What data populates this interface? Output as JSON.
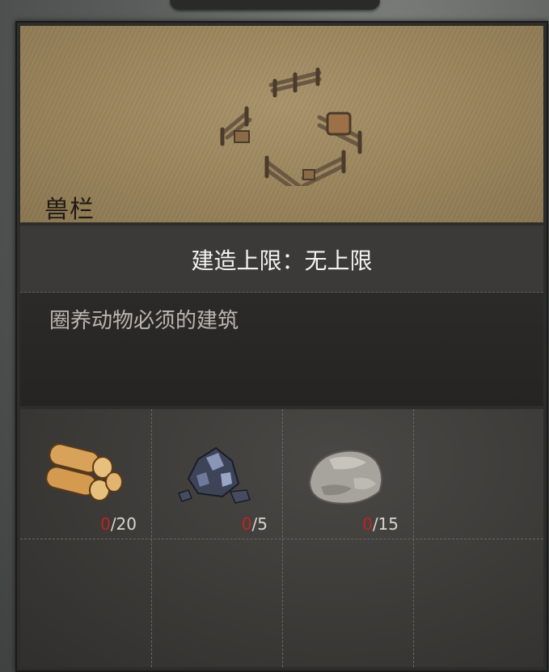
{
  "building": {
    "name": "兽栏",
    "limit_text": "建造上限：无上限",
    "description": "圈养动物必须的建筑",
    "icon": "fence-pen-icon"
  },
  "materials": [
    {
      "icon": "wood-logs-icon",
      "have": "0",
      "need": "/20"
    },
    {
      "icon": "iron-ore-icon",
      "have": "0",
      "need": "/5"
    },
    {
      "icon": "stone-icon",
      "have": "0",
      "need": "/15"
    }
  ],
  "colors": {
    "header_paper": "#9a855c",
    "shortage_red": "#c0231f"
  }
}
